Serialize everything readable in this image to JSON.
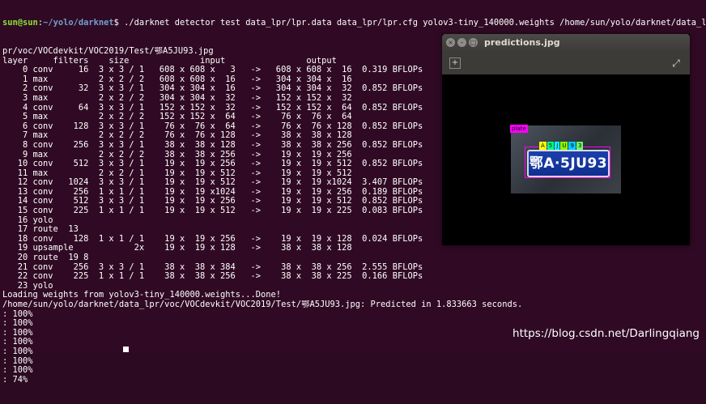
{
  "terminal": {
    "prompt_user": "sun@sun",
    "prompt_sep": ":",
    "prompt_path": "~/yolo/darknet",
    "command": "$ ./darknet detector test data_lpr/lpr.data data_lpr/lpr.cfg yolov3-tiny_140000.weights /home/sun/yolo/darknet/data_l",
    "lines": [
      "pr/voc/VOCdevkit/VOC2019/Test/鄂A5JU93.jpg",
      "layer     filters    size              input                output",
      "    0 conv     16  3 x 3 / 1   608 x 608 x   3   ->   608 x 608 x  16  0.319 BFLOPs",
      "    1 max          2 x 2 / 2   608 x 608 x  16   ->   304 x 304 x  16",
      "    2 conv     32  3 x 3 / 1   304 x 304 x  16   ->   304 x 304 x  32  0.852 BFLOPs",
      "    3 max          2 x 2 / 2   304 x 304 x  32   ->   152 x 152 x  32",
      "    4 conv     64  3 x 3 / 1   152 x 152 x  32   ->   152 x 152 x  64  0.852 BFLOPs",
      "    5 max          2 x 2 / 2   152 x 152 x  64   ->    76 x  76 x  64",
      "    6 conv    128  3 x 3 / 1    76 x  76 x  64   ->    76 x  76 x 128  0.852 BFLOPs",
      "    7 max          2 x 2 / 2    76 x  76 x 128   ->    38 x  38 x 128",
      "    8 conv    256  3 x 3 / 1    38 x  38 x 128   ->    38 x  38 x 256  0.852 BFLOPs",
      "    9 max          2 x 2 / 2    38 x  38 x 256   ->    19 x  19 x 256",
      "   10 conv    512  3 x 3 / 1    19 x  19 x 256   ->    19 x  19 x 512  0.852 BFLOPs",
      "   11 max          2 x 2 / 1    19 x  19 x 512   ->    19 x  19 x 512",
      "   12 conv   1024  3 x 3 / 1    19 x  19 x 512   ->    19 x  19 x1024  3.407 BFLOPs",
      "   13 conv    256  1 x 1 / 1    19 x  19 x1024   ->    19 x  19 x 256  0.189 BFLOPs",
      "   14 conv    512  3 x 3 / 1    19 x  19 x 256   ->    19 x  19 x 512  0.852 BFLOPs",
      "   15 conv    225  1 x 1 / 1    19 x  19 x 512   ->    19 x  19 x 225  0.083 BFLOPs",
      "   16 yolo",
      "   17 route  13",
      "   18 conv    128  1 x 1 / 1    19 x  19 x 256   ->    19 x  19 x 128  0.024 BFLOPs",
      "   19 upsample            2x    19 x  19 x 128   ->    38 x  38 x 128",
      "   20 route  19 8",
      "   21 conv    256  3 x 3 / 1    38 x  38 x 384   ->    38 x  38 x 256  2.555 BFLOPs",
      "   22 conv    225  1 x 1 / 1    38 x  38 x 256   ->    38 x  38 x 225  0.166 BFLOPs",
      "   23 yolo",
      "Loading weights from yolov3-tiny_140000.weights...Done!",
      "/home/sun/yolo/darknet/data_lpr/voc/VOCdevkit/VOC2019/Test/鄂A5JU93.jpg: Predicted in 1.833663 seconds.",
      ": 100%",
      ": 100%",
      ": 100%",
      ": 100%",
      ": 100%",
      ": 100%",
      ": 100%",
      ": 74%"
    ]
  },
  "watermark": "https://blog.csdn.net/Darlingqiang",
  "viewer": {
    "title": "predictions.jpg",
    "close_glyph": "×",
    "min_glyph": "–",
    "max_glyph": "□",
    "plate_text": "鄂A·5JU93",
    "plate_label": "plate",
    "char_labels": [
      "A",
      "5",
      "J",
      "U",
      "9",
      "3"
    ],
    "char_colors": [
      "#ffff00",
      "#00ff88",
      "#00ffff",
      "#88ff00",
      "#00ccff",
      "#66ff66"
    ],
    "plate_label_color": "#ff00ff"
  }
}
